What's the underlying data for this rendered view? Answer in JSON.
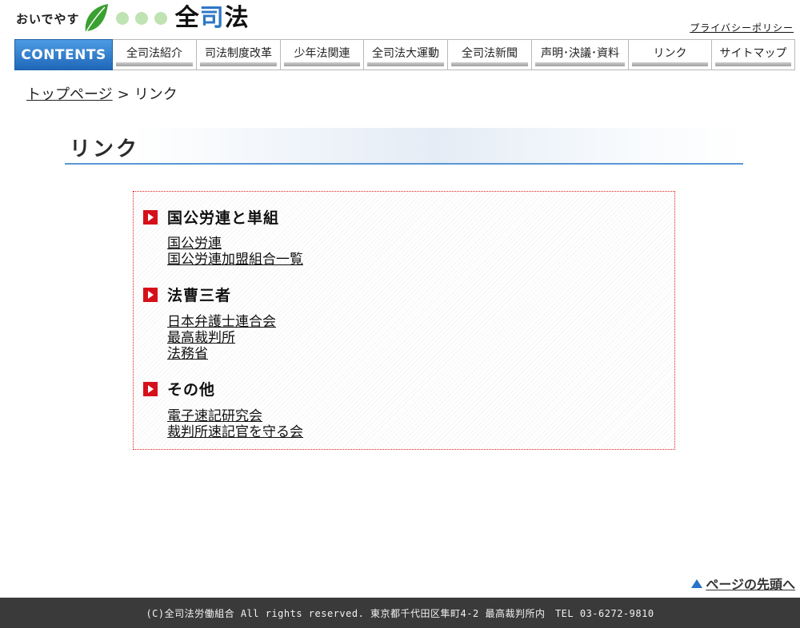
{
  "header": {
    "tagline": "おいでやす",
    "logo_name_prefix": "全",
    "logo_name_blue": "司",
    "logo_name_suffix": "法",
    "privacy_link": "プライバシーポリシー",
    "leaf_color": "#3aa032",
    "dot_color": "#bfe3b2",
    "accent_blue": "#2f77c7"
  },
  "nav": {
    "contents_label": "CONTENTS",
    "items": [
      {
        "label": "全司法紹介"
      },
      {
        "label": "司法制度改革"
      },
      {
        "label": "少年法関連"
      },
      {
        "label": "全司法大運動"
      },
      {
        "label": "全司法新聞"
      },
      {
        "label": "声明･決議･資料"
      },
      {
        "label": "リンク"
      },
      {
        "label": "サイトマップ"
      }
    ]
  },
  "breadcrumb": {
    "home": "トップページ",
    "separator": ">",
    "current": "リンク"
  },
  "page_title": "リンク",
  "sections": [
    {
      "title": "国公労連と単組",
      "links": [
        "国公労連",
        "国公労連加盟組合一覧"
      ]
    },
    {
      "title": "法曹三者",
      "links": [
        "日本弁護士連合会",
        "最高裁判所",
        "法務省"
      ]
    },
    {
      "title": "その他",
      "links": [
        "電子速記研究会",
        "裁判所速記官を守る会"
      ]
    }
  ],
  "page_top_label": "ページの先頭へ",
  "footer_text": "(C)全司法労働組合 All rights reserved. 東京都千代田区隼町4-2 最高裁判所内　TEL 03-6272-9810"
}
